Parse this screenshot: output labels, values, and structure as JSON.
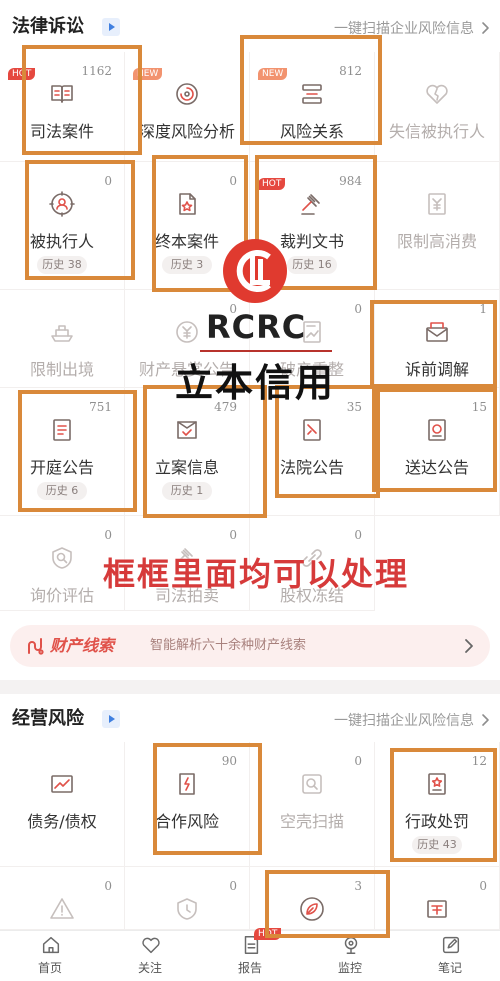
{
  "colors": {
    "accent": "#e0524a",
    "annotation": "#d9893a",
    "caption": "#d63a3a",
    "logo": "#e03a2f",
    "badge_hot": "#e5483f",
    "badge_new": "#f2936f",
    "banner_bg": "#fcefee",
    "section_icon": "#3f7fe0"
  },
  "legal_section": {
    "title": "法律诉讼",
    "title_icon": "play-icon",
    "scan_link": "一键扫描企业风险信息",
    "items": [
      {
        "label": "司法案件",
        "count": 1162,
        "badge": "HOT",
        "icon": "book-icon"
      },
      {
        "label": "深度风险分析",
        "badge": "NEW",
        "icon": "radar-icon"
      },
      {
        "label": "风险关系",
        "count": 812,
        "badge": "NEW",
        "icon": "relation-icon"
      },
      {
        "label": "失信被执行人",
        "icon": "broken-heart-icon",
        "dimmed": true
      },
      {
        "label": "被执行人",
        "count": 0,
        "history": "历史 38",
        "icon": "person-target-icon"
      },
      {
        "label": "终本案件",
        "count": 0,
        "history": "历史 3",
        "icon": "star-document-icon"
      },
      {
        "label": "裁判文书",
        "count": 984,
        "badge": "HOT",
        "history": "历史 16",
        "icon": "gavel-icon"
      },
      {
        "label": "限制高消费",
        "icon": "yuan-document-icon",
        "dimmed": true
      },
      {
        "label": "限制出境",
        "icon": "ship-icon",
        "dimmed": true
      },
      {
        "label": "财产悬赏公告",
        "count": 0,
        "icon": "yuan-circle-icon",
        "dimmed": true
      },
      {
        "label": "破产重整",
        "count": 0,
        "icon": "bankrupt-icon",
        "dimmed": true
      },
      {
        "label": "诉前调解",
        "count": 1,
        "icon": "envelope-icon"
      },
      {
        "label": "开庭公告",
        "count": 751,
        "history": "历史 6",
        "icon": "list-document-icon"
      },
      {
        "label": "立案信息",
        "count": 479,
        "history": "历史 1",
        "icon": "check-document-icon"
      },
      {
        "label": "法院公告",
        "count": 35,
        "icon": "court-notice-icon"
      },
      {
        "label": "送达公告",
        "count": 15,
        "icon": "seal-document-icon"
      },
      {
        "label": "询价评估",
        "count": 0,
        "icon": "price-search-icon",
        "dimmed": true
      },
      {
        "label": "司法拍卖",
        "count": 0,
        "icon": "auction-icon",
        "dimmed": true
      },
      {
        "label": "股权冻结",
        "count": 0,
        "icon": "equity-freeze-icon",
        "dimmed": true
      }
    ]
  },
  "asset_banner": {
    "icon": "clue-icon",
    "title": "财产线索",
    "subtitle": "智能解析六十余种财产线索"
  },
  "business_section": {
    "title": "经营风险",
    "title_icon": "play-icon",
    "scan_link": "一键扫描企业风险信息",
    "items": [
      {
        "label": "债务/债权",
        "icon": "debt-icon"
      },
      {
        "label": "合作风险",
        "count": 90,
        "icon": "cooperation-icon"
      },
      {
        "label": "空壳扫描",
        "count": 0,
        "icon": "shell-scan-icon",
        "dimmed": true
      },
      {
        "label": "行政处罚",
        "count": 12,
        "history": "历史 43",
        "icon": "penalty-icon"
      },
      {
        "count": 0,
        "icon": "warning-icon",
        "dimmed": true
      },
      {
        "count": 0,
        "icon": "shield-icon",
        "dimmed": true
      },
      {
        "count": 3,
        "icon": "leaf-icon"
      },
      {
        "count": 0,
        "icon": "tax-icon"
      }
    ]
  },
  "overlay": {
    "watermark_brand": "RCRC",
    "watermark_name": "立本信用",
    "caption": "框框里面均可以处理"
  },
  "tab_bar": {
    "items": [
      {
        "label": "首页",
        "icon": "home-icon"
      },
      {
        "label": "关注",
        "icon": "heart-icon"
      },
      {
        "label": "报告",
        "icon": "report-icon",
        "badge": "HOT"
      },
      {
        "label": "监控",
        "icon": "camera-icon"
      },
      {
        "label": "笔记",
        "icon": "note-icon"
      }
    ]
  }
}
